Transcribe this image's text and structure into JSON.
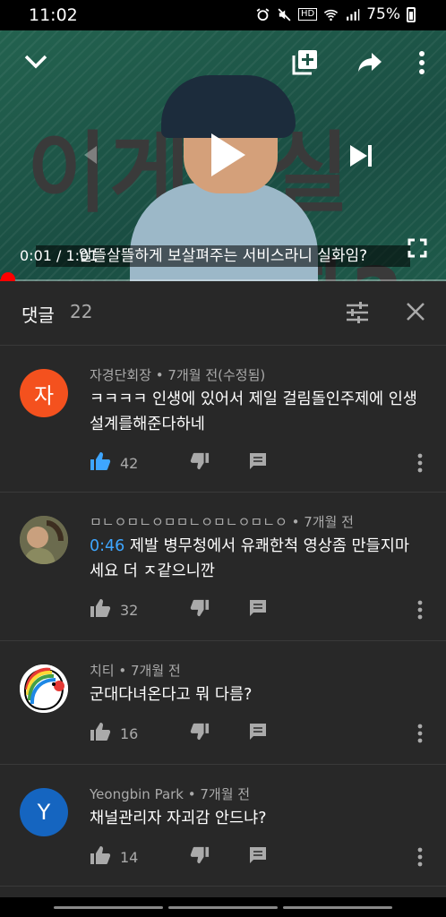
{
  "status_bar": {
    "time": "11:02",
    "battery": "75%",
    "hd_label": "HD"
  },
  "video": {
    "big_text_left": "이게",
    "big_text_right": "실화?",
    "caption": "알뜰살뜰하게 보살펴주는 서비스라니 실화임?",
    "time": "0:01 / 1:01",
    "progress": 0.016
  },
  "comments_header": {
    "title": "댓글",
    "count": "22"
  },
  "comments": [
    {
      "avatar_letter": "자",
      "avatar_color": "#f4511e",
      "author": "자경단회장",
      "time": "7개월 전(수정됨)",
      "text": "ㅋㅋㅋㅋ 인생에 있어서 제일 걸림돌인주제에 인생 설계를해준다하네",
      "likes": "42",
      "liked": true
    },
    {
      "avatar_letter": "",
      "avatar_color": "#6b6b4e",
      "author": "ㅁㄴㅇㅁㄴㅇㅁㅁㄴㅇㅁㄴㅇㅁㄴㅇ",
      "time": "7개월 전",
      "timestamp": "0:46",
      "text": " 제발 병무청에서 유쾌한척 영상좀 만들지마세요 더 ㅈ같으니깐",
      "likes": "32",
      "liked": false
    },
    {
      "avatar_letter": "",
      "avatar_color": "#ffffff",
      "author": "치티",
      "time": "7개월 전",
      "text": "군대다녀온다고 뭐 다름?",
      "likes": "16",
      "liked": false
    },
    {
      "avatar_letter": "Y",
      "avatar_color": "#1565c0",
      "author": "Yeongbin Park",
      "time": "7개월 전",
      "text": "채널관리자 자괴감 안드냐?",
      "likes": "14",
      "liked": false
    }
  ]
}
